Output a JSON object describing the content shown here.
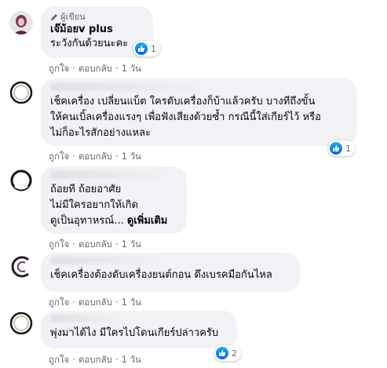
{
  "comments": [
    {
      "badge": "ผู้เขียน",
      "author": "เจ๊ม้อยv plus",
      "lines": [
        "ระวังกันด้วยนะคะ"
      ],
      "reaction_count": "1",
      "like": "ถูกใจ",
      "reply": "ตอบกลับ",
      "time": "1 วัน"
    },
    {
      "lines": [
        "เช็คเครื่อง เปลี่ยนแบ็ต ใครดับเครื่องก็บ้าแล้วครับ บางทีถึงขั้น",
        "ให้คนเบิ้ลเครื่องแรงๆ เพื่อฟังเสียงด้วยซ้ำ กรณีนี้ใส่เกียร์ไว้ หรือ",
        "ไม่ก็อะไรสักอย่างแหละ"
      ],
      "reaction_count": "1",
      "like": "ถูกใจ",
      "reply": "ตอบกลับ",
      "time": "1 วัน"
    },
    {
      "lines": [
        "ถ้อยที ถ้อยอาศัย",
        "ไม่มีใครอยากให้เกิด",
        "ดูเป็นอุทาหรณ์..."
      ],
      "see_more": "ดูเพิ่มเติม",
      "like": "ถูกใจ",
      "reply": "ตอบกลับ",
      "time": "1 วัน"
    },
    {
      "lines": [
        "เช็คเครื่องต้องดับเครื่องยนต์กอน ดึงเบรคมือกันไหล"
      ],
      "like": "ถูกใจ",
      "reply": "ตอบกลับ",
      "time": "1 วัน"
    },
    {
      "lines": [
        "พุ่งมาได้ไง มีใครไปโดนเกียร์ปล่าวครับ"
      ],
      "reaction_count": "2",
      "like": "ถูกใจ",
      "reply": "ตอบกลับ",
      "time": "1 วัน"
    }
  ],
  "icons": {
    "like": "thumbs-up-icon",
    "badge": "pencil-icon"
  },
  "colors": {
    "bubble": "#f0f2f5",
    "like_blue": "#1877f2",
    "meta_text": "#65676b"
  }
}
